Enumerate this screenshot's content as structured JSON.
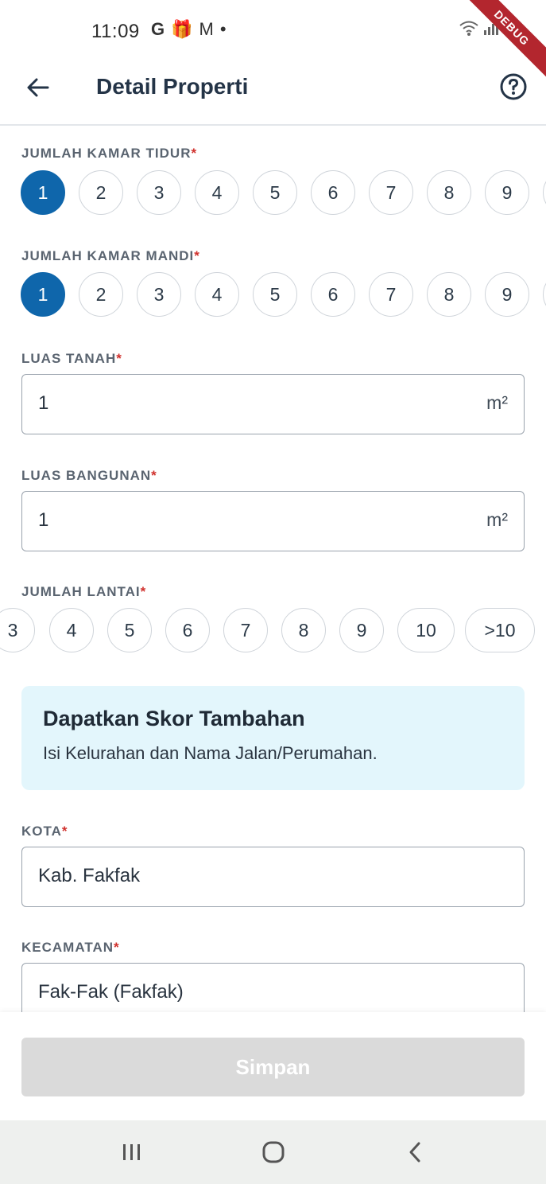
{
  "status_bar": {
    "time": "11:09",
    "left_icons": [
      "G",
      "🎁",
      "M",
      "•"
    ],
    "right_icons": [
      "wifi-icon",
      "signal-icon"
    ],
    "debug_label": "DEBUG"
  },
  "app_bar": {
    "title": "Detail Properti",
    "back_icon": "arrow-left-icon",
    "help_icon": "question-circle-icon"
  },
  "bedrooms": {
    "label": "JUMLAH KAMAR TIDUR",
    "required_mark": "*",
    "options": [
      "1",
      "2",
      "3",
      "4",
      "5",
      "6",
      "7",
      "8",
      "9"
    ],
    "selected": "1"
  },
  "bathrooms": {
    "label": "JUMLAH KAMAR MANDI",
    "required_mark": "*",
    "options": [
      "1",
      "2",
      "3",
      "4",
      "5",
      "6",
      "7",
      "8",
      "9"
    ],
    "selected": "1"
  },
  "land_area": {
    "label": "LUAS TANAH",
    "required_mark": "*",
    "value": "1",
    "unit": "m²"
  },
  "building_area": {
    "label": "LUAS BANGUNAN",
    "required_mark": "*",
    "value": "1",
    "unit": "m²"
  },
  "floors": {
    "label": "JUMLAH LANTAI",
    "required_mark": "*",
    "options": [
      "3",
      "4",
      "5",
      "6",
      "7",
      "8",
      "9",
      "10",
      ">10"
    ]
  },
  "info": {
    "title": "Dapatkan Skor Tambahan",
    "text": "Isi Kelurahan dan Nama Jalan/Perumahan."
  },
  "city": {
    "label": "KOTA",
    "required_mark": "*",
    "value": "Kab. Fakfak"
  },
  "district": {
    "label": "KECAMATAN",
    "required_mark": "*",
    "value": "Fak-Fak (Fakfak)"
  },
  "save_button": {
    "label": "Simpan"
  },
  "colors": {
    "primary": "#0f66ab",
    "required": "#d0312d",
    "info_bg": "#e3f6fc",
    "disabled_button": "#dadada"
  }
}
